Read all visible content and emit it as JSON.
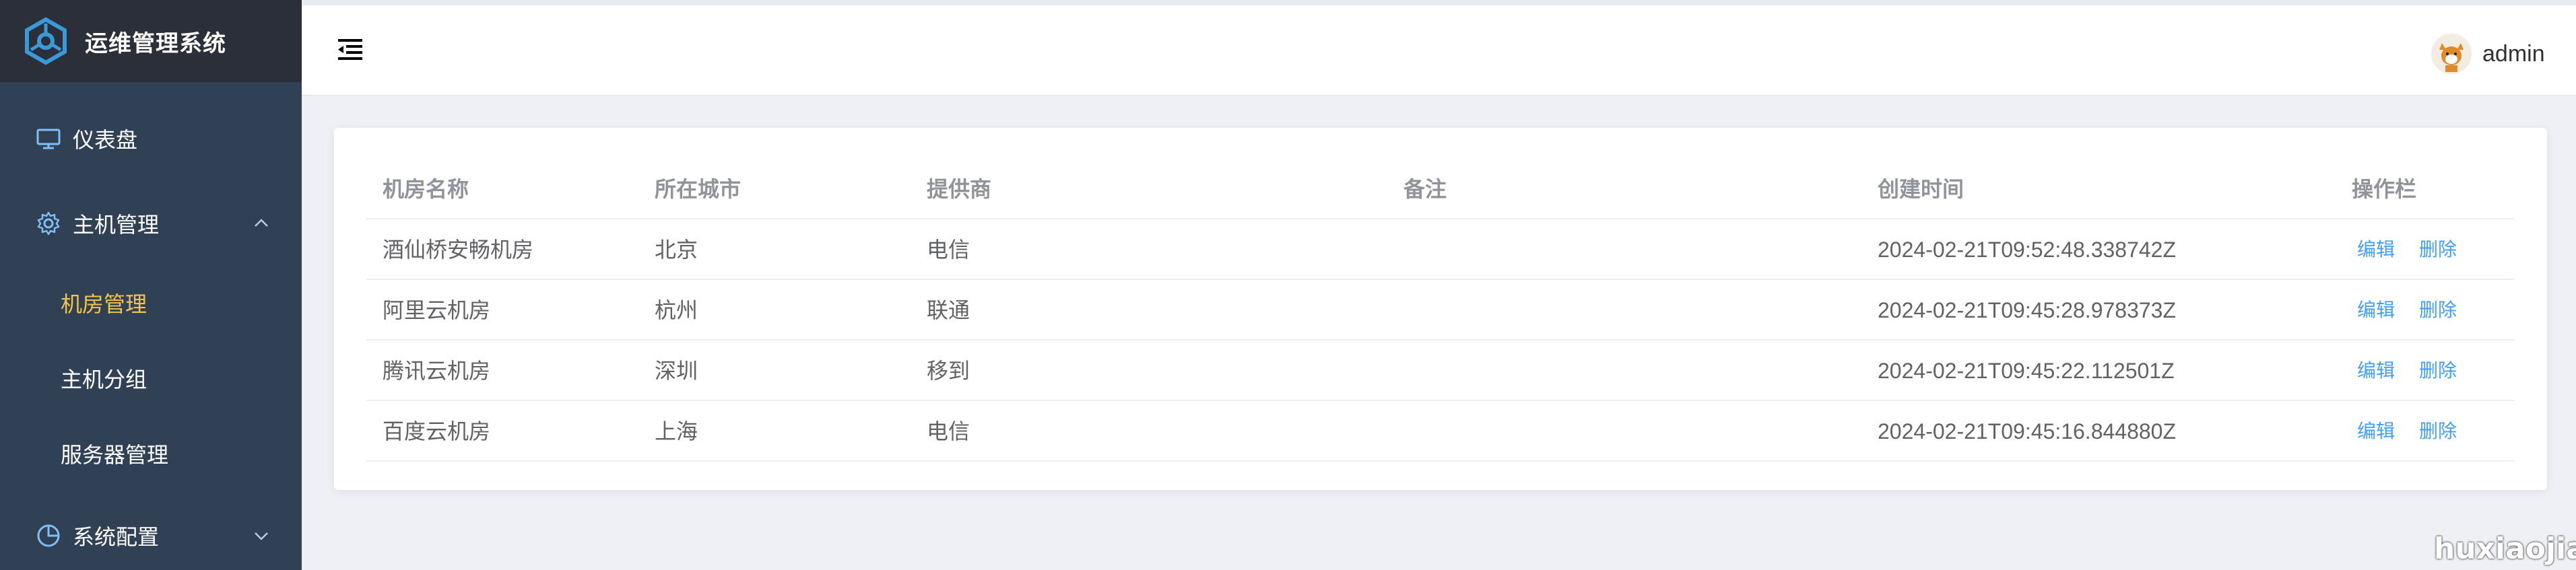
{
  "app": {
    "title": "运维管理系统"
  },
  "sidebar": {
    "dashboard": "仪表盘",
    "host_management": {
      "label": "主机管理",
      "children": [
        "机房管理",
        "主机分组",
        "服务器管理"
      ]
    },
    "system_config": "系统配置"
  },
  "header": {
    "user": "admin"
  },
  "table": {
    "headers": [
      "机房名称",
      "所在城市",
      "提供商",
      "备注",
      "创建时间",
      "操作栏"
    ],
    "rows": [
      {
        "name": "酒仙桥安畅机房",
        "city": "北京",
        "provider": "电信",
        "note": "",
        "created": "2024-02-21T09:52:48.338742Z"
      },
      {
        "name": "阿里云机房",
        "city": "杭州",
        "provider": "联通",
        "note": "",
        "created": "2024-02-21T09:45:28.978373Z"
      },
      {
        "name": "腾讯云机房",
        "city": "深圳",
        "provider": "移到",
        "note": "",
        "created": "2024-02-21T09:45:22.112501Z"
      },
      {
        "name": "百度云机房",
        "city": "上海",
        "provider": "电信",
        "note": "",
        "created": "2024-02-21T09:45:16.844880Z"
      }
    ],
    "edit_label": "编辑",
    "delete_label": "删除"
  },
  "watermark": "huxiaojian",
  "colors": {
    "sidebar_bg": "#304156",
    "logo_bg": "#2b2f3a",
    "active_menu": "#f4c545",
    "link": "#409eff"
  }
}
